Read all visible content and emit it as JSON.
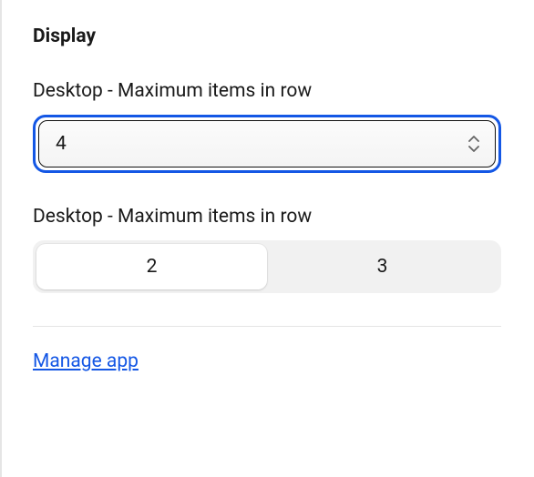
{
  "section": {
    "title": "Display"
  },
  "fields": {
    "desktop_max_select": {
      "label": "Desktop - Maximum items in row",
      "value": "4"
    },
    "desktop_max_seg": {
      "label": "Desktop - Maximum items in row",
      "options": {
        "opt0": "2",
        "opt1": "3"
      },
      "selected_index": 0
    }
  },
  "link": {
    "manage_app": "Manage app"
  }
}
